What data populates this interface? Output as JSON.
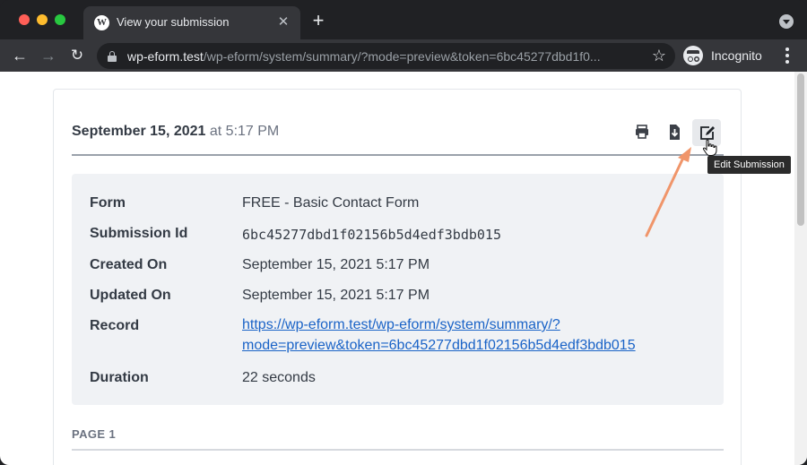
{
  "browser": {
    "tab": {
      "title": "View your submission",
      "favicon_icon": "wordpress-icon"
    },
    "url": {
      "host": "wp-eform.test",
      "path": "/wp-eform/system/summary/?mode=preview&token=6bc45277dbd1f0..."
    },
    "profile_label": "Incognito"
  },
  "submission": {
    "date": "September 15, 2021",
    "time_suffix": "at 5:17 PM",
    "tooltip": "Edit Submission",
    "fields": {
      "form_label": "Form",
      "form_value": "FREE - Basic Contact Form",
      "id_label": "Submission Id",
      "id_value": "6bc45277dbd1f02156b5d4edf3bdb015",
      "created_label": "Created On",
      "created_value": "September 15, 2021 5:17 PM",
      "updated_label": "Updated On",
      "updated_value": "September 15, 2021 5:17 PM",
      "record_label": "Record",
      "record_line1": "https://wp-eform.test/wp-eform/system/summary/?",
      "record_line2": "mode=preview&token=6bc45277dbd1f02156b5d4edf3bdb015",
      "duration_label": "Duration",
      "duration_value": "22 seconds"
    },
    "page_label": "PAGE 1"
  },
  "colors": {
    "arrow": "#f0956a",
    "link": "#1a63c7"
  }
}
